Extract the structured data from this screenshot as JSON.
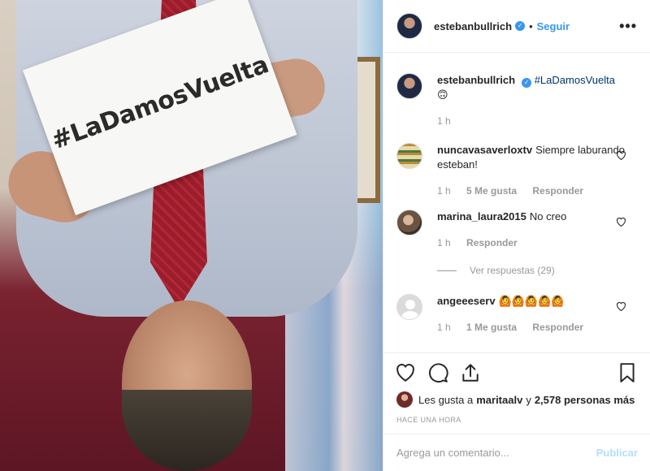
{
  "post": {
    "image_text": "#LaDamosVuelta",
    "image_alt": "photo"
  },
  "header": {
    "username": "estebanbullrich",
    "follow_label": "Seguir",
    "more_label": "•••"
  },
  "caption": {
    "username": "estebanbullrich",
    "text": "#LaDamosVuelta",
    "emoji": "🙃",
    "time": "1 h"
  },
  "comments": [
    {
      "username": "nuncavasaverloxtv",
      "text": "Siempre laburando esteban!",
      "time": "1 h",
      "likes": "5 Me gusta",
      "reply": "Responder"
    },
    {
      "username": "marina_laura2015",
      "text": "No creo",
      "time": "1 h",
      "reply": "Responder",
      "view_replies": "Ver respuestas (29)"
    },
    {
      "username": "angeeeserv",
      "text": "🙆🙆🙆🙆🙆",
      "time": "1 h",
      "likes": "1 Me gusta",
      "reply": "Responder"
    },
    {
      "username": "",
      "text": ""
    }
  ],
  "likes": {
    "prefix": "Les gusta a",
    "user": "maritaalv",
    "conj": "y",
    "count": "2,578 personas más"
  },
  "timestamp": "HACE UNA HORA",
  "add_comment": {
    "placeholder": "Agrega un comentario...",
    "post_label": "Publicar"
  }
}
